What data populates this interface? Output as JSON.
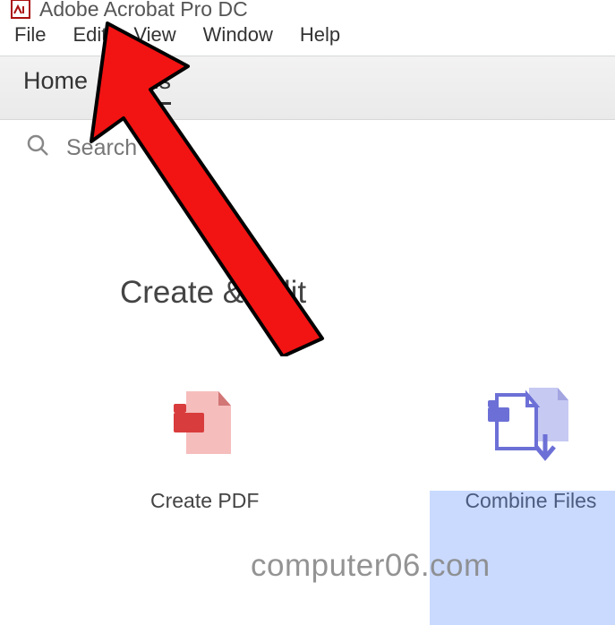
{
  "title": "Adobe Acrobat Pro DC",
  "menu": {
    "file": "File",
    "edit": "Edit",
    "view": "View",
    "window": "Window",
    "help": "Help"
  },
  "tabs": {
    "home": "Home",
    "tools": "Tools"
  },
  "search": {
    "placeholder": "Search tools"
  },
  "section": {
    "title": "Create & Edit"
  },
  "tools": {
    "create_pdf": "Create PDF",
    "combine_files": "Combine Files"
  },
  "watermark": "computer06.com",
  "palette": {
    "red_light": "#f6bdbd",
    "red_dark": "#d93c3c",
    "blue_light": "#c6c9f2",
    "blue_dark": "#6c70d6",
    "arrow": "#f21313"
  }
}
